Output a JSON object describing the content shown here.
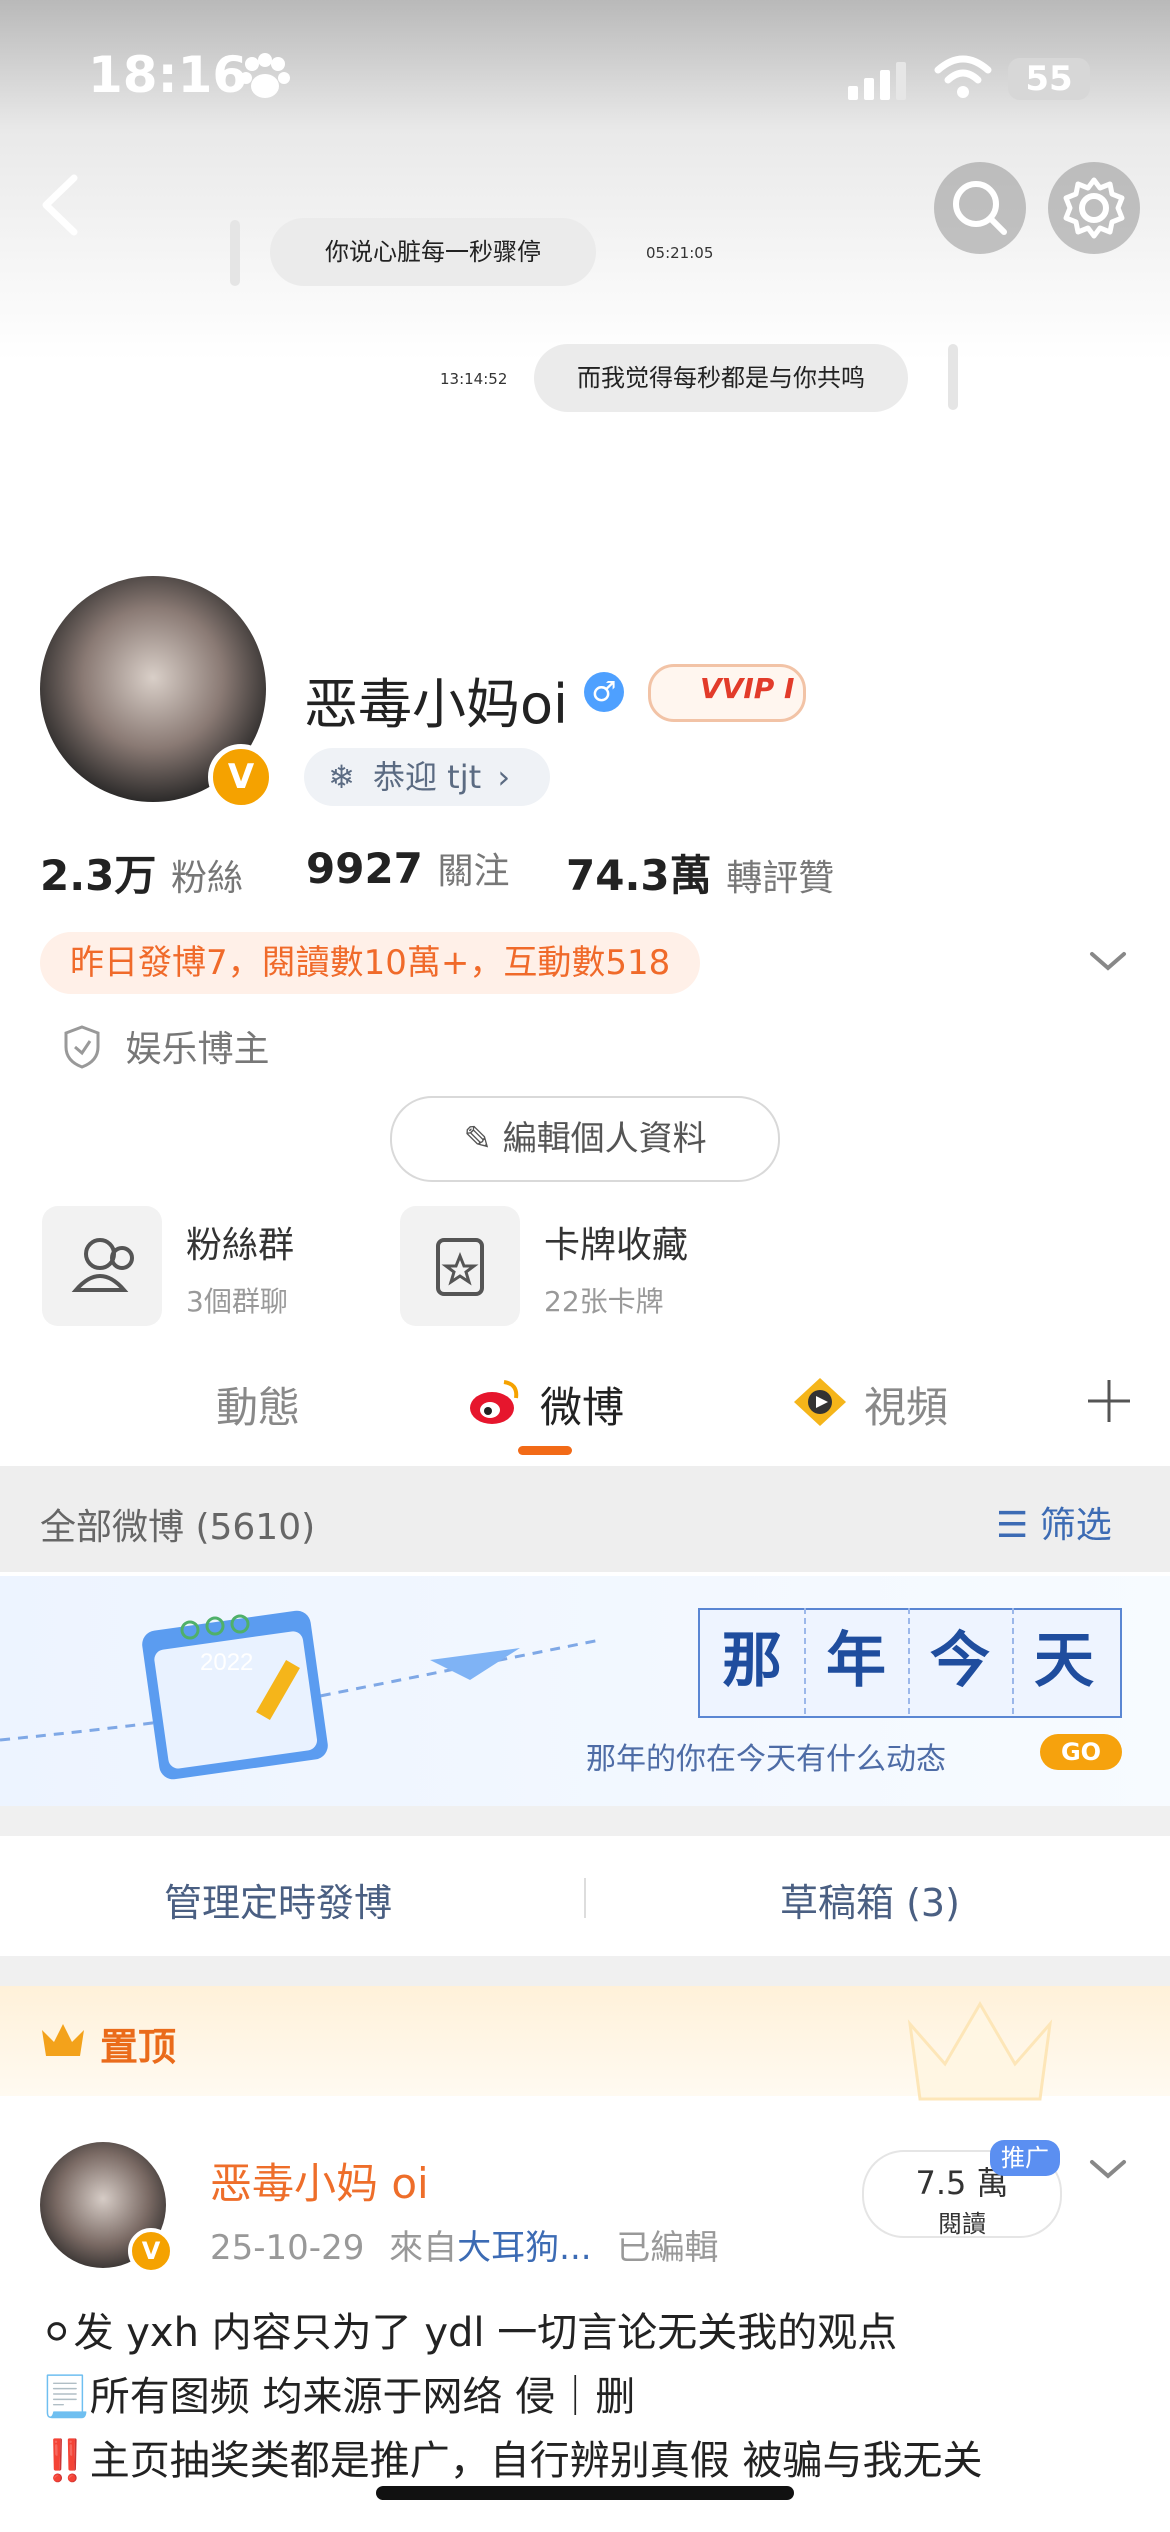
{
  "status_bar": {
    "time": "18:16",
    "battery": "55"
  },
  "chat": {
    "message_left": "你说心脏每一秒骤停",
    "time_left": "05:21:05",
    "time_right": "13:14:52",
    "message_right": "而我觉得每秒都是与你共鸣"
  },
  "profile": {
    "name": "恶毒小妈oi",
    "vvip_label": "VVIP I",
    "welcome": "恭迎 tjt",
    "stats": [
      {
        "value": "2.3万",
        "label": "粉絲"
      },
      {
        "value": "9927",
        "label": "關注"
      },
      {
        "value": "74.3萬",
        "label": "轉評贊"
      }
    ],
    "yesterday": "昨日發博7，閱讀數10萬+，互動數518",
    "tag": "娱乐博主",
    "edit": "編輯個人資料",
    "cards": [
      {
        "title": "粉絲群",
        "sub": "3個群聊"
      },
      {
        "title": "卡牌收藏",
        "sub": "22张卡牌"
      }
    ]
  },
  "tabs": {
    "dynamic": "動態",
    "weibo": "微博",
    "video": "視頻"
  },
  "section": {
    "all": "全部微博 (5610)",
    "filter": "筛选"
  },
  "banner": {
    "chars": [
      "那",
      "年",
      "今",
      "天"
    ],
    "sub": "那年的你在今天有什么动态",
    "go": "GO",
    "calendar_year": "2022"
  },
  "manage": {
    "schedule": "管理定時發博",
    "drafts": "草稿箱 (3)"
  },
  "pinned": {
    "label": "置顶"
  },
  "post": {
    "name": "恶毒小妈 oi",
    "date": "25-10-29",
    "from": "來自",
    "source": "大耳狗...",
    "edited": "已編輯",
    "reads": "7.5 萬",
    "reads_label": "閱讀",
    "promo": "推广",
    "lines": [
      "⚪发 yxh 内容只为了 ydl 一切言论无关我的观点",
      "📃所有图频 均来源于网络 侵｜删",
      "‼️主页抽奖类都是推广，自行辨别真假 被骗与我无关"
    ]
  },
  "colors": {
    "accent": "#f26a17",
    "link": "#3c6bb4",
    "vip": "#f5a200"
  }
}
